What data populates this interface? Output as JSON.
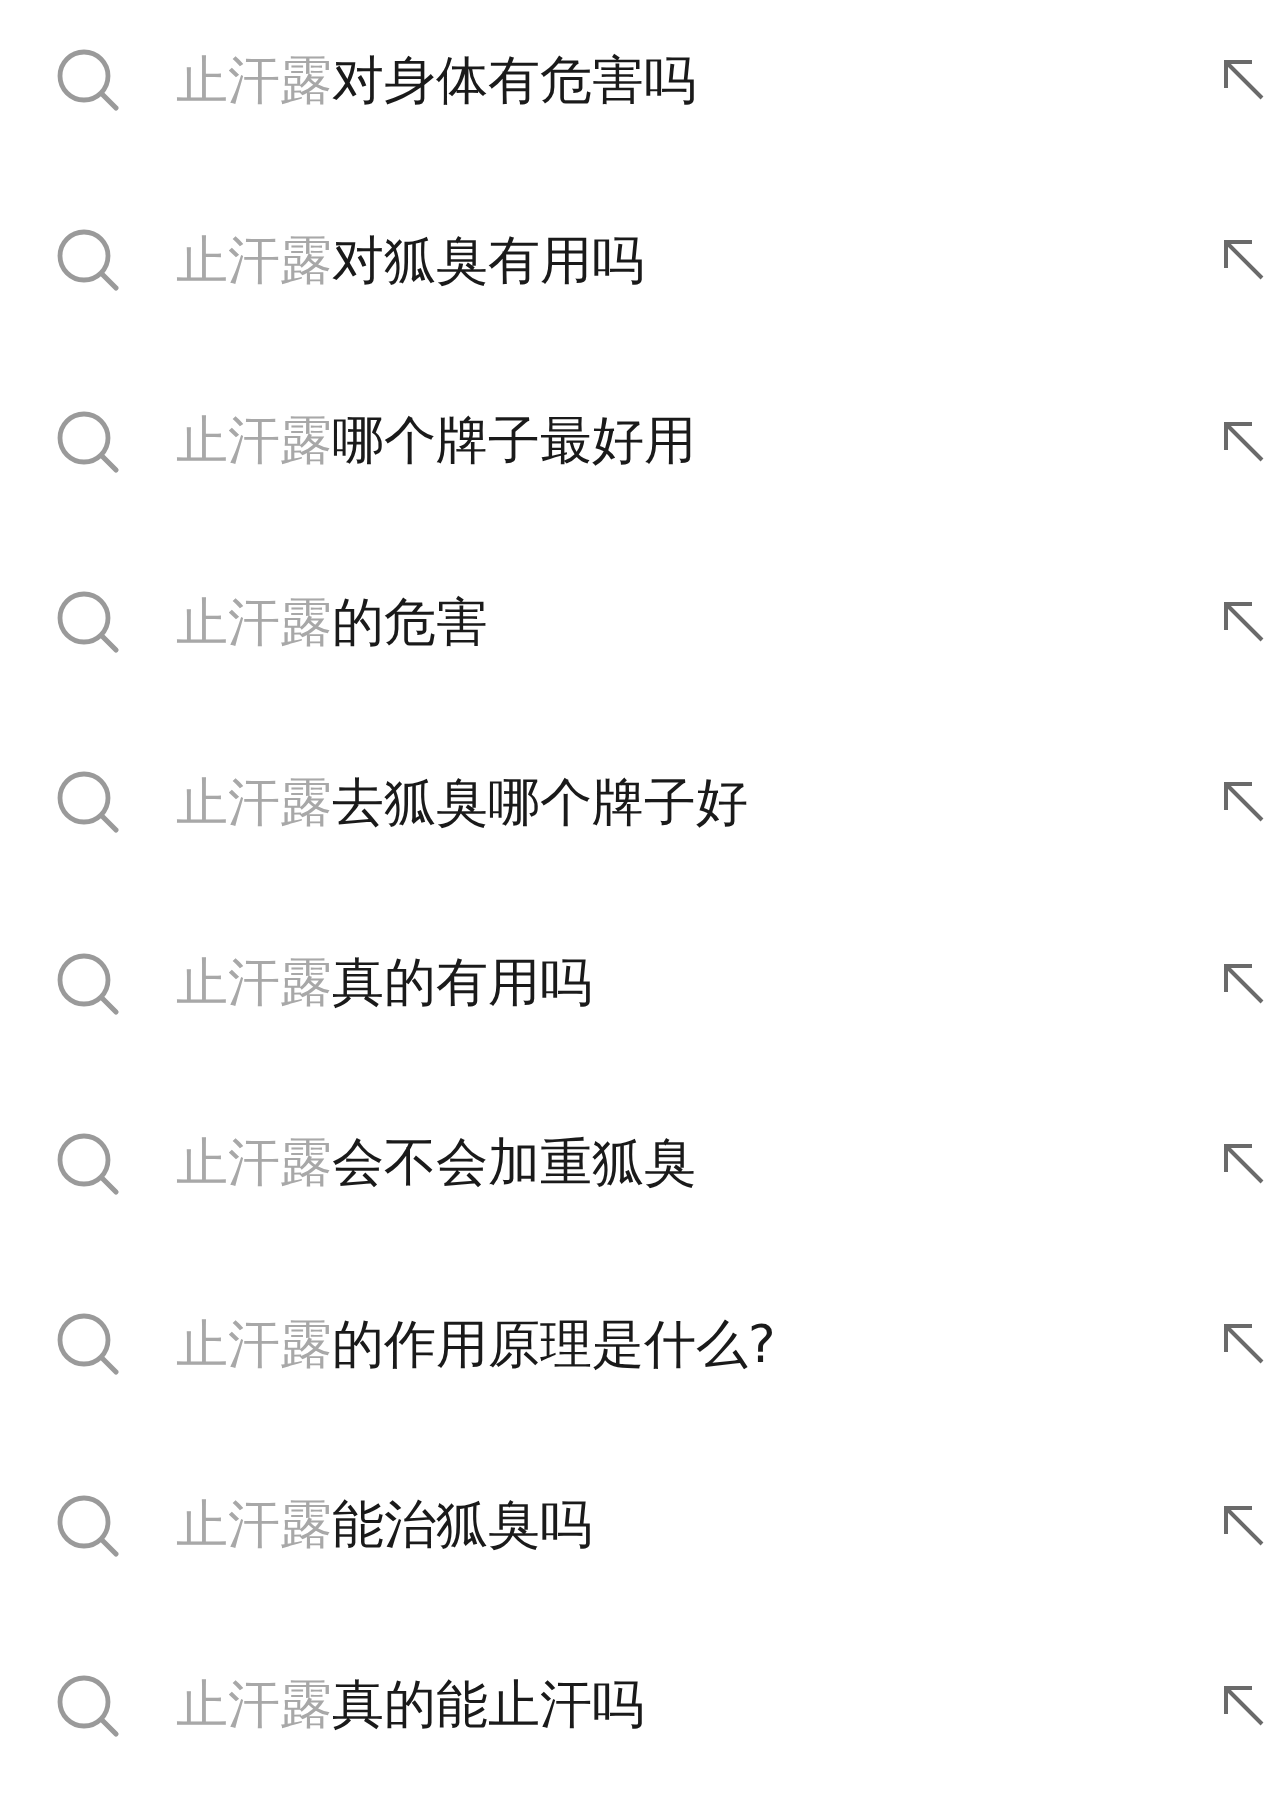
{
  "suggestions": [
    {
      "prefix": "止汗露",
      "suffix": "对身体有危害吗"
    },
    {
      "prefix": "止汗露",
      "suffix": "对狐臭有用吗"
    },
    {
      "prefix": "止汗露",
      "suffix": "哪个牌子最好用"
    },
    {
      "prefix": "止汗露",
      "suffix": "的危害"
    },
    {
      "prefix": "止汗露",
      "suffix": "去狐臭哪个牌子好"
    },
    {
      "prefix": "止汗露",
      "suffix": "真的有用吗"
    },
    {
      "prefix": "止汗露",
      "suffix": "会不会加重狐臭"
    },
    {
      "prefix": "止汗露",
      "suffix": "的作用原理是什么?"
    },
    {
      "prefix": "止汗露",
      "suffix": "能治狐臭吗"
    },
    {
      "prefix": "止汗露",
      "suffix": "真的能止汗吗"
    }
  ]
}
